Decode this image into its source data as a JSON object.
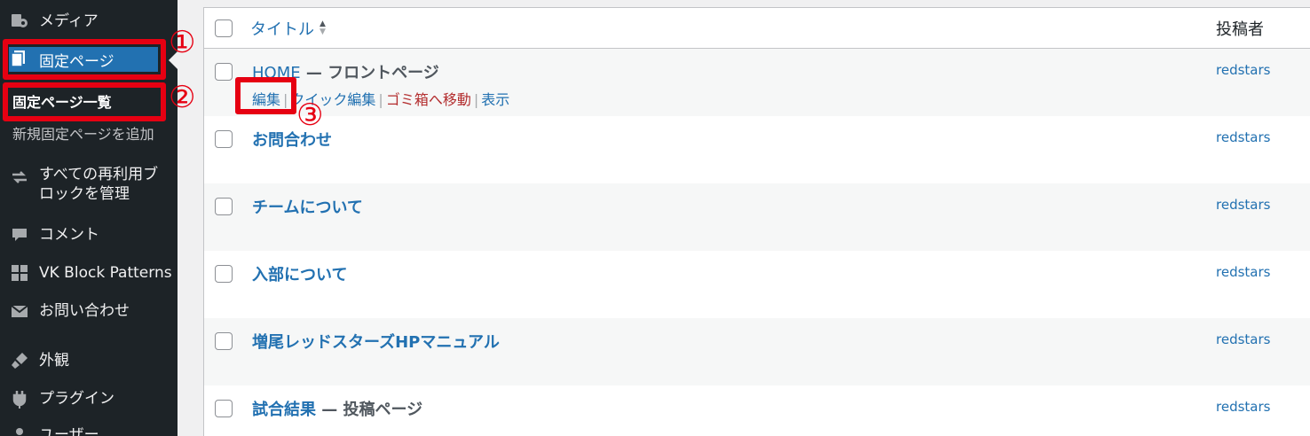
{
  "sidebar": {
    "items": [
      {
        "label": "メディア",
        "icon": "media-icon"
      },
      {
        "label": "固定ページ",
        "icon": "pages-icon",
        "current": true
      },
      {
        "label": "すべての再利用ブロックを管理",
        "icon": "reusable-block-icon"
      },
      {
        "label": "コメント",
        "icon": "comment-icon"
      },
      {
        "label": "VK Block Patterns",
        "icon": "grid-icon"
      },
      {
        "label": "お問い合わせ",
        "icon": "mail-icon"
      },
      {
        "label": "外観",
        "icon": "appearance-brush-icon"
      },
      {
        "label": "プラグイン",
        "icon": "plugin-icon"
      },
      {
        "label": "ユーザー",
        "icon": "user-icon"
      }
    ],
    "submenu": {
      "list_label": "固定ページ一覧",
      "add_label": "新規固定ページを追加"
    }
  },
  "annotations": {
    "one": "①",
    "two": "②",
    "three": "③",
    "highlight_color": "#e60012"
  },
  "table": {
    "header": {
      "title_label": "タイトル",
      "sort_up": "▲",
      "sort_down": "▼",
      "author_label": "投稿者"
    },
    "rows": [
      {
        "title": "HOME",
        "state": " — フロントページ",
        "author": "redstars"
      },
      {
        "title": "お問合わせ",
        "state": "",
        "author": "redstars"
      },
      {
        "title": "チームについて",
        "state": "",
        "author": "redstars"
      },
      {
        "title": "入部について",
        "state": "",
        "author": "redstars"
      },
      {
        "title": "増尾レッドスターズHPマニュアル",
        "state": "",
        "author": "redstars"
      },
      {
        "title": "試合結果",
        "state": " — 投稿ページ",
        "author": "redstars"
      }
    ],
    "row_actions": {
      "edit": "編集",
      "quick_edit": "クイック編集",
      "trash": "ゴミ箱へ移動",
      "view": "表示",
      "separator": "|"
    }
  },
  "colors": {
    "sidebar_bg": "#1d2327",
    "accent": "#2271b1",
    "trash": "#b32d2e"
  }
}
